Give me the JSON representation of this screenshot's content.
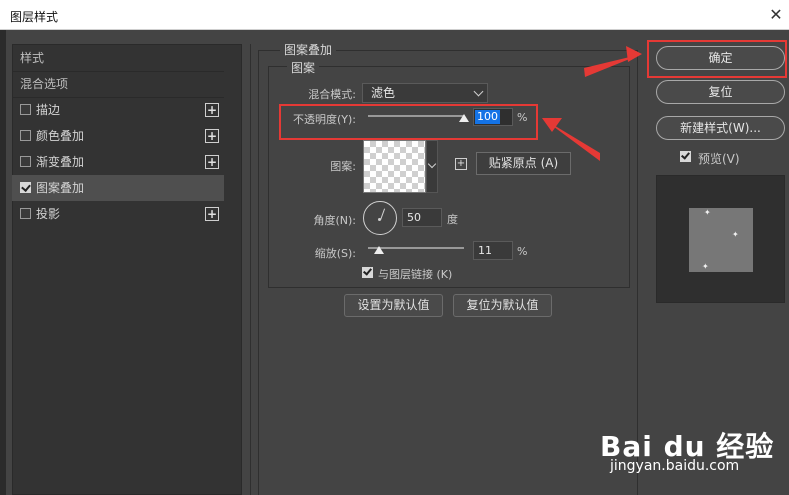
{
  "window": {
    "title": "图层样式",
    "close_glyph": "✕"
  },
  "left_panel": {
    "header_label": "样式",
    "blend_options_label": "混合选项",
    "items": [
      {
        "label": "描边",
        "checked": false,
        "has_add": true
      },
      {
        "label": "颜色叠加",
        "checked": false,
        "has_add": true
      },
      {
        "label": "渐变叠加",
        "checked": false,
        "has_add": true
      },
      {
        "label": "图案叠加",
        "checked": true,
        "has_add": false,
        "selected": true
      },
      {
        "label": "投影",
        "checked": false,
        "has_add": true
      }
    ],
    "add_glyph": "+"
  },
  "pattern_overlay": {
    "group_title": "图案叠加",
    "sub_group_title": "图案",
    "blend_mode_label": "混合模式:",
    "blend_mode_value": "滤色",
    "opacity_label": "不透明度(Y):",
    "opacity_value": "100",
    "opacity_unit": "%",
    "opacity_fraction": 1.0,
    "pattern_label": "图案:",
    "new_preset_glyph": "+",
    "snap_origin_label": "贴紧原点 (A)",
    "angle_label": "角度(N):",
    "angle_value": "50",
    "angle_unit": "度",
    "scale_label": "缩放(S):",
    "scale_value": "11",
    "scale_unit": "%",
    "scale_fraction": 0.11,
    "link_label": "与图层链接 (K)",
    "link_checked": true,
    "make_default_label": "设置为默认值",
    "reset_default_label": "复位为默认值"
  },
  "right_panel": {
    "ok_label": "确定",
    "reset_label": "复位",
    "new_style_label": "新建样式(W)...",
    "preview_label": "预览(V)",
    "preview_checked": true,
    "spark_glyph": "✦"
  },
  "watermark": {
    "logo": "Bai du 经验",
    "url": "jingyan.baidu.com"
  },
  "colors": {
    "highlight": "#e53935",
    "selection_blue": "#1473e6",
    "dialog_bg": "#444444"
  }
}
